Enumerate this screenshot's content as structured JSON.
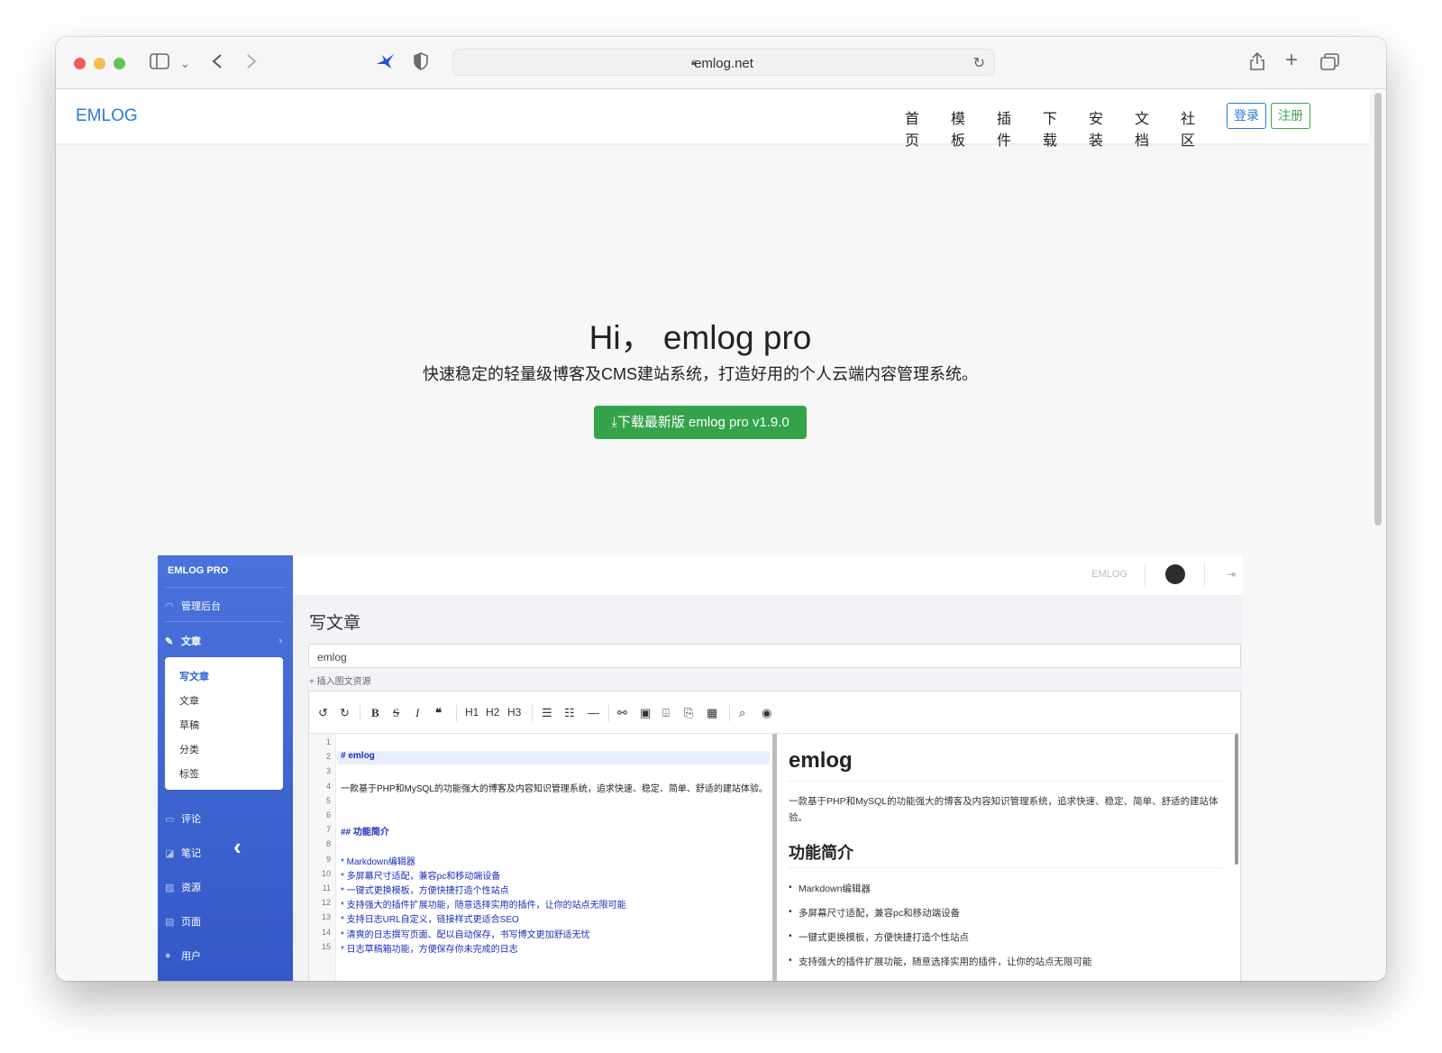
{
  "browser": {
    "url": "emlog.net",
    "traffic_lights": {
      "close": "#ee5e56",
      "minimize": "#f5bd4f",
      "zoom": "#60c554"
    }
  },
  "site": {
    "brand": "EMLOG",
    "nav": [
      "首页",
      "模板",
      "插件",
      "下载",
      "安装",
      "文档",
      "社区"
    ],
    "login": "登录",
    "register": "注册",
    "accent": "#2b7cd3",
    "green": "#34a34a"
  },
  "hero": {
    "title": "Hi， emlog pro",
    "subtitle": "快速稳定的轻量级博客及CMS建站系统，打造好用的个人云端内容管理系统。",
    "download_button": "下载最新版 emlog pro v1.9.0"
  },
  "admin": {
    "brand": "EMLOG PRO",
    "sidebar": {
      "dashboard": "管理后台",
      "articles": "文章",
      "submenu": [
        "写文章",
        "文章",
        "草稿",
        "分类",
        "标签"
      ],
      "comments": "评论",
      "notes": "笔记",
      "resources": "资源",
      "pages": "页面",
      "users": "用户"
    },
    "topbar_brand": "EMLOG",
    "page_title": "写文章",
    "title_value": "emlog",
    "insert_resources": "+ 插入图文资源",
    "toolbar_headings": [
      "H1",
      "H2",
      "H3"
    ],
    "code_lines": [
      {
        "n": "1",
        "t": ""
      },
      {
        "n": "2",
        "t": "# emlog"
      },
      {
        "n": "3",
        "t": ""
      },
      {
        "n": "4",
        "t": "一款基于PHP和MySQL的功能强大的博客及内容知识管理系统，追求快速、稳定、简单、舒适的建站体验。"
      },
      {
        "n": "5",
        "t": ""
      },
      {
        "n": "6",
        "t": ""
      },
      {
        "n": "7",
        "t": "## 功能简介"
      },
      {
        "n": "8",
        "t": ""
      },
      {
        "n": "9",
        "t": "* Markdown编辑器"
      },
      {
        "n": "10",
        "t": "* 多屏幕尺寸适配，兼容pc和移动端设备"
      },
      {
        "n": "11",
        "t": "* 一键式更换模板，方便快捷打造个性站点"
      },
      {
        "n": "12",
        "t": "* 支持强大的插件扩展功能，随意选择实用的插件，让你的站点无限可能"
      },
      {
        "n": "13",
        "t": "* 支持日志URL自定义，链接样式更适合SEO"
      },
      {
        "n": "14",
        "t": "* 清爽的日志撰写页面、配以自动保存，书写博文更加舒适无忧"
      },
      {
        "n": "15",
        "t": "* 日志草稿箱功能，方便保存你未完成的日志"
      }
    ],
    "preview": {
      "h1": "emlog",
      "p": "一款基于PHP和MySQL的功能强大的博客及内容知识管理系统，追求快速、稳定、简单、舒适的建站体验。",
      "h2": "功能简介",
      "list": [
        "Markdown编辑器",
        "多屏幕尺寸适配，兼容pc和移动端设备",
        "一键式更换模板，方便快捷打造个性站点",
        "支持强大的插件扩展功能，随意选择实用的插件，让你的站点无限可能"
      ]
    }
  }
}
